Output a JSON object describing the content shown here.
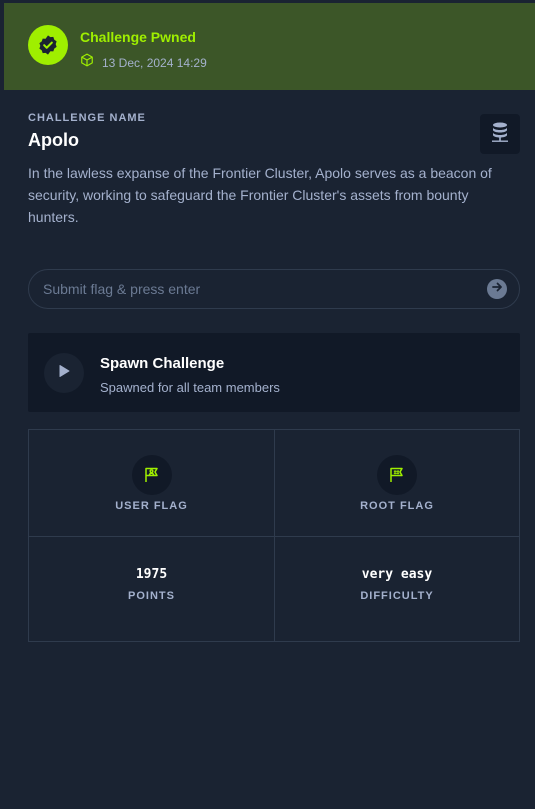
{
  "banner": {
    "status": "Challenge Pwned",
    "date": "13 Dec, 2024 14:29"
  },
  "challenge": {
    "section_label": "CHALLENGE NAME",
    "name": "Apolo",
    "description": "In the lawless expanse of the Frontier Cluster, Apolo serves as a beacon of security, working to safeguard the Frontier Cluster's assets from bounty hunters."
  },
  "flag_input": {
    "placeholder": "Submit flag & press enter",
    "value": ""
  },
  "spawn": {
    "title": "Spawn Challenge",
    "subtitle": "Spawned for all team members"
  },
  "stats": {
    "user_flag_label": "USER FLAG",
    "root_flag_label": "ROOT FLAG",
    "points_value": "1975",
    "points_label": "POINTS",
    "difficulty_value": "very easy",
    "difficulty_label": "DIFFICULTY"
  },
  "icons": {
    "badge": "verified-check-icon",
    "date": "cube-icon",
    "database": "database-icon",
    "submit": "arrow-right-circle-icon",
    "spawn": "play-icon",
    "user_flag": "user-flag-icon",
    "root_flag": "root-flag-icon"
  },
  "colors": {
    "accent": "#9fef00",
    "background": "#1a2332",
    "card": "#111927",
    "banner": "#3c5628",
    "muted_text": "#a4b1cd"
  }
}
